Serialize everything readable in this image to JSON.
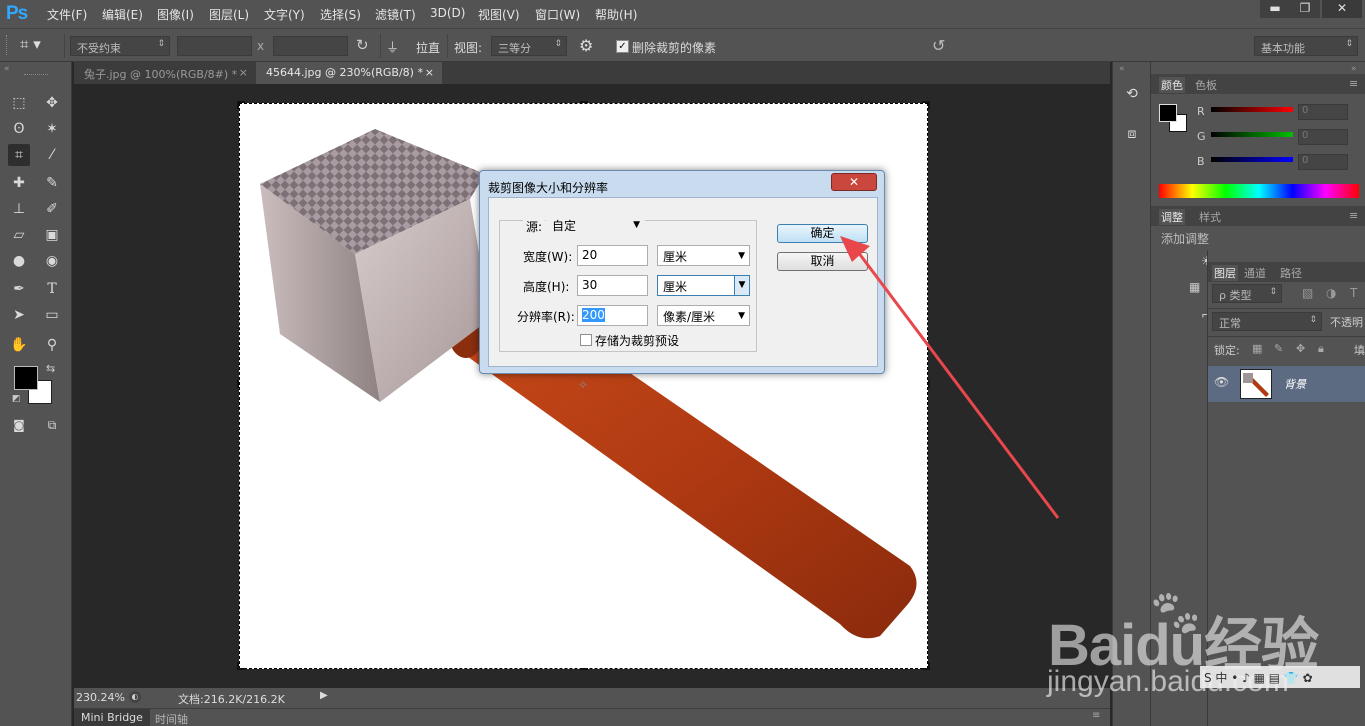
{
  "app": {
    "logo": "Ps"
  },
  "menu": [
    "文件(F)",
    "编辑(E)",
    "图像(I)",
    "图层(L)",
    "文字(Y)",
    "选择(S)",
    "滤镜(T)",
    "3D(D)",
    "视图(V)",
    "窗口(W)",
    "帮助(H)"
  ],
  "window_controls": {
    "minimize": "▬",
    "restore": "❐",
    "close": "✕"
  },
  "options": {
    "ratio_select": "不受约束",
    "x_sep": "x",
    "straighten": "拉直",
    "view_label": "视图:",
    "view_select": "三等分",
    "delete_pixels_label": "删除裁剪的像素",
    "delete_pixels_checked": true,
    "workspace": "基本功能"
  },
  "tabs": [
    {
      "label": "兔子.jpg @ 100%(RGB/8#) *",
      "close": "×",
      "active": false
    },
    {
      "label": "45644.jpg @ 230%(RGB/8) *",
      "close": "×",
      "active": true
    }
  ],
  "status": {
    "zoom": "230.24%",
    "doc": "文档:216.2K/216.2K"
  },
  "bottom_tabs": [
    "Mini Bridge",
    "时间轴"
  ],
  "color_panel": {
    "tabs": [
      "颜色",
      "色板"
    ],
    "channels": [
      {
        "label": "R",
        "value": "0",
        "color": "#ff0000"
      },
      {
        "label": "G",
        "value": "0",
        "color": "#00c000"
      },
      {
        "label": "B",
        "value": "0",
        "color": "#0000ff"
      }
    ]
  },
  "adjust_panel": {
    "tabs": [
      "调整",
      "样式"
    ],
    "add_label": "添加调整"
  },
  "layers_panel": {
    "tabs": [
      "图层",
      "通道",
      "路径"
    ],
    "kind_filter": "ρ 类型",
    "blend_mode": "正常",
    "opacity_label": "不透明",
    "lock_label": "锁定:",
    "fill_label": "填",
    "layer_name": "背景"
  },
  "dialog": {
    "title": "裁剪图像大小和分辨率",
    "close": "✕",
    "source_label": "源:",
    "source_value": "自定",
    "width_label": "宽度(W):",
    "width_value": "20",
    "width_unit": "厘米",
    "height_label": "高度(H):",
    "height_value": "30",
    "height_unit": "厘米",
    "resolution_label": "分辨率(R):",
    "resolution_value": "200",
    "resolution_unit": "像素/厘米",
    "save_preset_label": "存储为裁剪预设",
    "save_preset_checked": false,
    "ok": "确定",
    "cancel": "取消"
  },
  "annotation": {
    "arrow_color": "#e8474c"
  },
  "watermark": {
    "brand": "Baidu经验",
    "url": "jingyan.baidu.com"
  }
}
